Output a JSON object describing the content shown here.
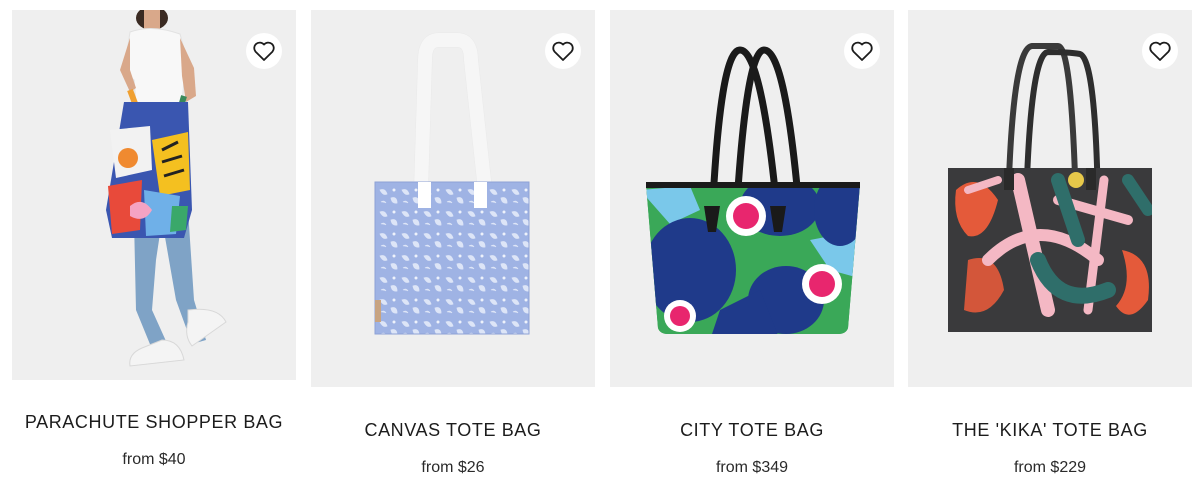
{
  "products": [
    {
      "name": "PARACHUTE SHOPPER BAG",
      "price": "from $40",
      "image": "woman-carrying-colorful-shopper-bag",
      "favorite_icon": "heart-outline-icon"
    },
    {
      "name": "CANVAS TOTE BAG",
      "price": "from $26",
      "image": "light-blue-floral-canvas-tote",
      "favorite_icon": "heart-outline-icon"
    },
    {
      "name": "CITY TOTE BAG",
      "price": "from $349",
      "image": "navy-green-floral-leather-tote",
      "favorite_icon": "heart-outline-icon"
    },
    {
      "name": "THE 'KIKA' TOTE BAG",
      "price": "from $229",
      "image": "dark-brushstroke-pattern-tote",
      "favorite_icon": "heart-outline-icon"
    }
  ],
  "colors": {
    "image_background": "#efefef",
    "text": "#1c1c1c",
    "page_background": "#ffffff"
  }
}
